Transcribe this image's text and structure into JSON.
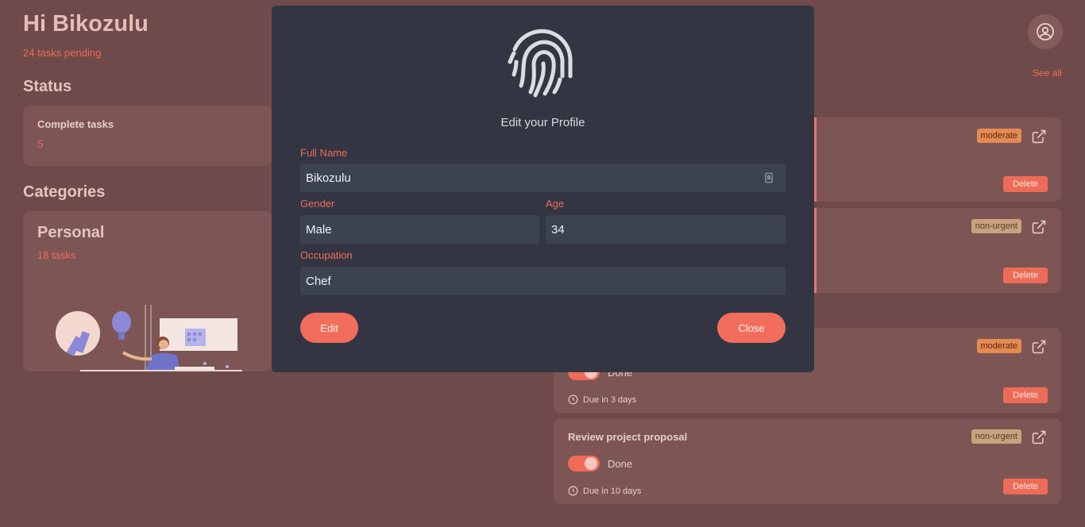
{
  "header": {
    "greeting": "Hi Bikozulu",
    "pending": "24 tasks pending"
  },
  "status": {
    "title": "Status",
    "complete_label": "Complete tasks",
    "complete_value": "5"
  },
  "categories": {
    "title": "Categories",
    "card_title": "Personal",
    "card_count": "18 tasks"
  },
  "tasks_panel": {
    "see_all": "See all"
  },
  "tasks": [
    {
      "tag": "moderate",
      "delete": "Delete"
    },
    {
      "tag": "non-urgent",
      "delete": "Delete"
    },
    {
      "tag": "moderate",
      "done": "Done",
      "due": "Due in 3 days",
      "delete": "Delete"
    },
    {
      "title": "Review project proposal",
      "tag": "non-urgent",
      "done": "Done",
      "due": "Due in 10 days",
      "delete": "Delete"
    }
  ],
  "modal": {
    "title": "Edit your Profile",
    "full_name_label": "Full Name",
    "full_name_value": "Bikozulu",
    "gender_label": "Gender",
    "gender_value": "Male",
    "age_label": "Age",
    "age_value": "34",
    "occupation_label": "Occupation",
    "occupation_value": "Chef",
    "edit_button": "Edit",
    "close_button": "Close"
  },
  "icons": {
    "fingerprint": "fingerprint-icon",
    "profile": "user-circle-icon",
    "external_link": "external-link-icon",
    "clock": "clock-icon",
    "contact_card": "contact-card-icon"
  },
  "colors": {
    "background": "#6f4a4a",
    "accent": "#ee6c57",
    "modal": "#333642",
    "tag_moderate": "#e48b51",
    "tag_non_urgent": "#c8a27c"
  }
}
